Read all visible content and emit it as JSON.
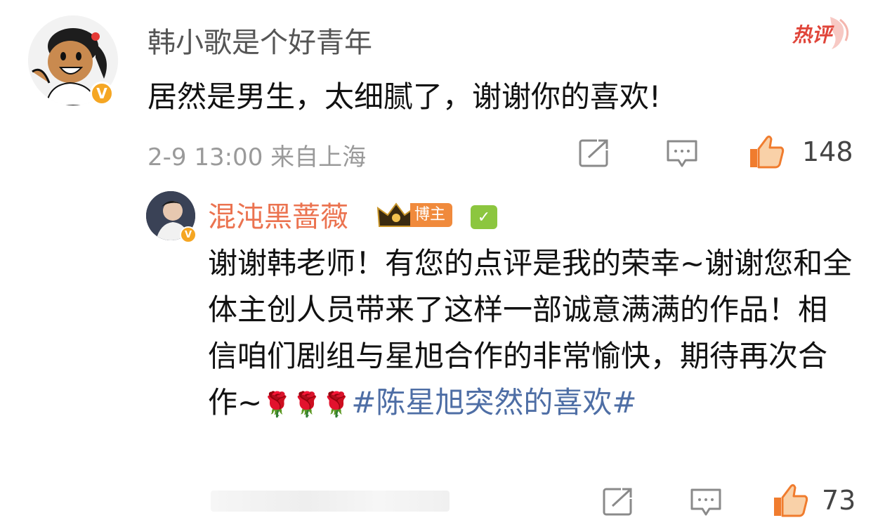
{
  "comment": {
    "username": "韩小歌是个好青年",
    "hot_label": "热评",
    "text": "居然是男生，太细腻了，谢谢你的喜欢!",
    "date": "2-9 13:00",
    "location": "来自上海",
    "like_count": "148",
    "verify_mark": "V"
  },
  "reply": {
    "username": "混沌黑蔷薇",
    "badge_label": "博主",
    "check_mark": "✓",
    "text_main": "谢谢韩老师！有您的点评是我的荣幸~谢谢您和全体主创人员带来了这样一部诚意满满的作品！相信咱们剧组与星旭合作的非常愉快，期待再次合作~",
    "roses": "🌹🌹🌹",
    "hashtag": "#陈星旭突然的喜欢#",
    "like_count": "73",
    "verify_mark": "V"
  },
  "colors": {
    "username_reply": "#eb7350",
    "hashtag": "#4e6ea5",
    "like_accent": "#f07c2e",
    "verify": "#f5a623",
    "hot": "#e0453a"
  },
  "icons": {
    "share": "share-icon",
    "comment": "comment-icon",
    "like": "thumbs-up-icon"
  }
}
